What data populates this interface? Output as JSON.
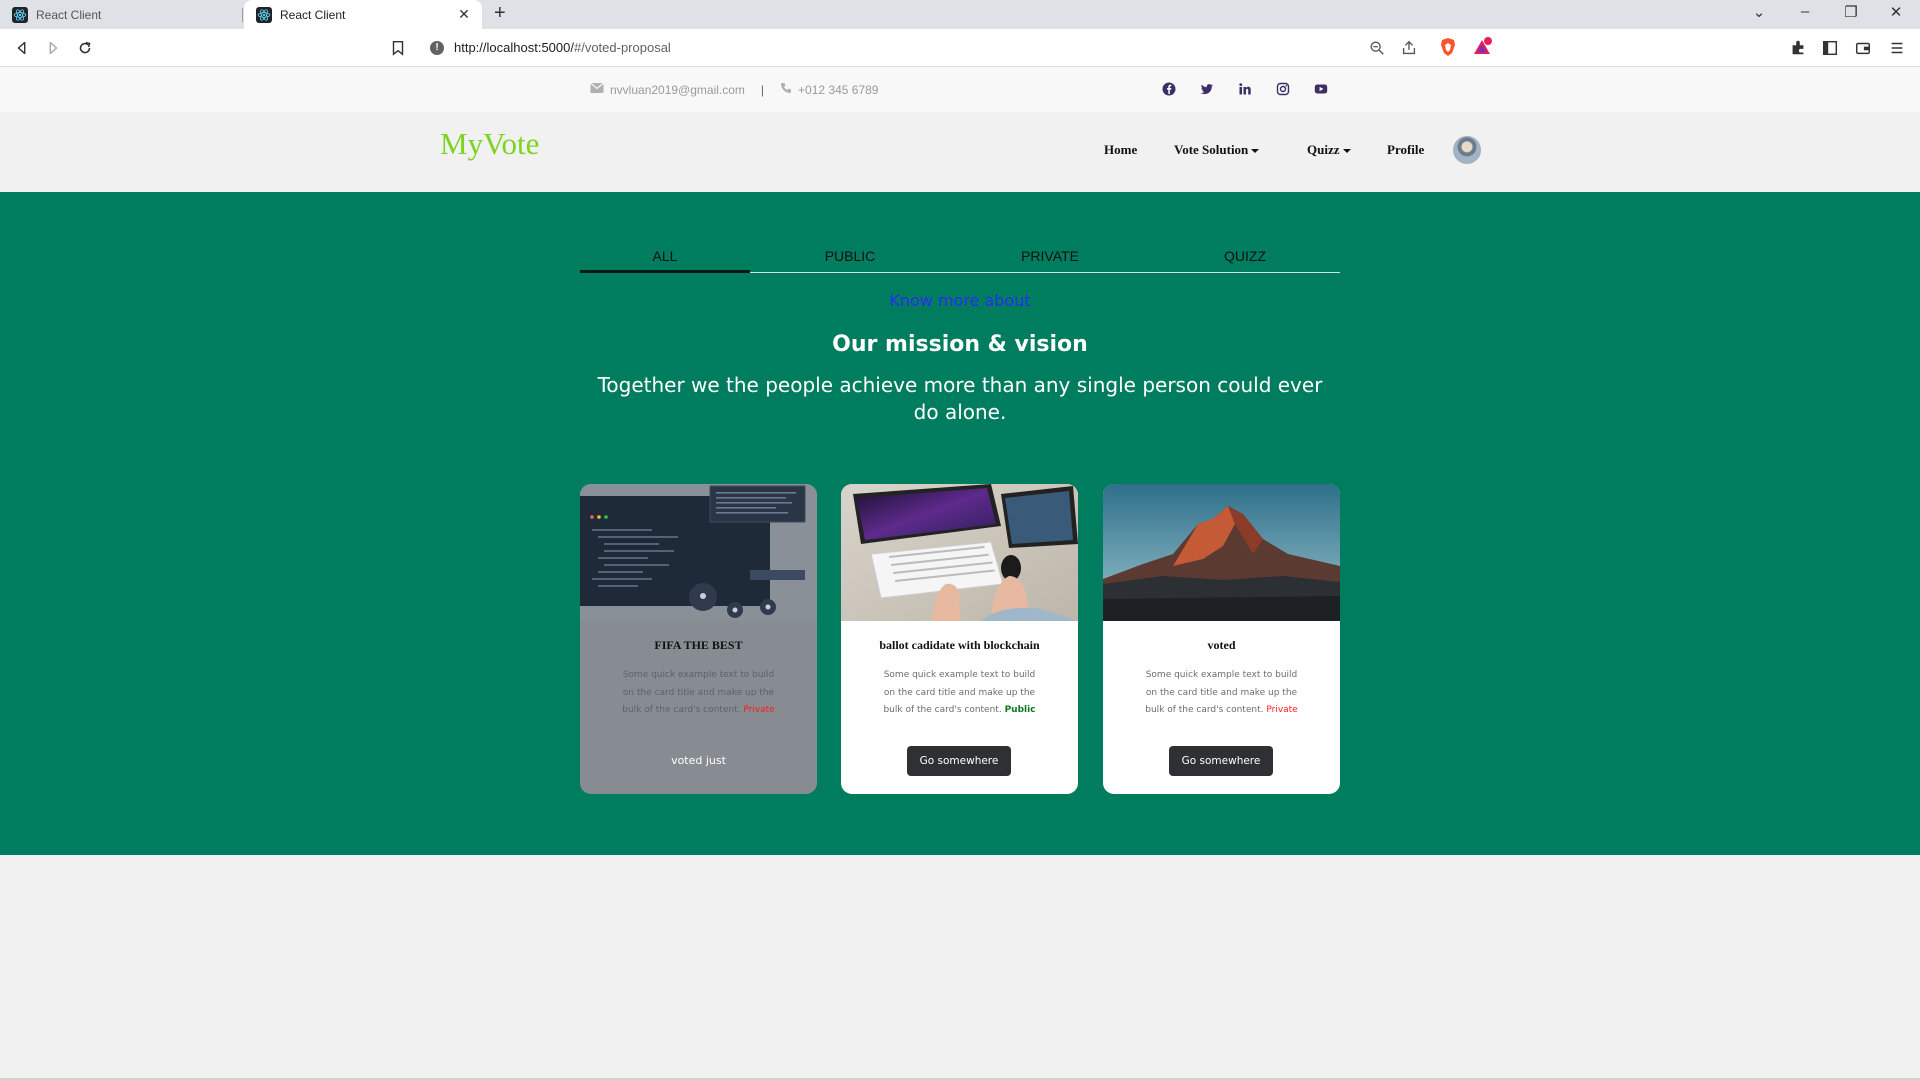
{
  "browser": {
    "tabs": [
      {
        "title": "React Client",
        "active": false
      },
      {
        "title": "React Client",
        "active": true
      }
    ],
    "url_host": "http://localhost:5000/",
    "url_path": "#/voted-proposal"
  },
  "topbar": {
    "email": "nvvluan2019@gmail.com",
    "separator": "|",
    "phone": "+012 345 6789",
    "social": [
      "facebook-icon",
      "twitter-icon",
      "linkedin-icon",
      "instagram-icon",
      "youtube-icon"
    ]
  },
  "navbar": {
    "brand": "MyVote",
    "links": [
      "Home",
      "Vote Solution",
      "Quizz",
      "Profile"
    ]
  },
  "hero": {
    "tabs": [
      "ALL",
      "PUBLIC",
      "PRIVATE",
      "QUIZZ"
    ],
    "active_tab": "ALL",
    "know_more": "Know more about",
    "mission_title": "Our mission & vision",
    "tagline": "Together we the people achieve more than any single person could ever do alone."
  },
  "cards": [
    {
      "title": "FIFA THE BEST",
      "text": "Some quick example text to build on the card title and make up the bulk of the card's content.",
      "badge": "Private",
      "action": "voted just",
      "disabled": true
    },
    {
      "title": "ballot cadidate with blockchain",
      "text": "Some quick example text to build on the card title and make up the bulk of the card's content.",
      "badge": "Public",
      "action": "Go somewhere",
      "disabled": false
    },
    {
      "title": "voted",
      "text": "Some quick example text to build on the card title and make up the bulk of the card's content.",
      "badge": "Private",
      "action": "Go somewhere",
      "disabled": false
    }
  ],
  "colors": {
    "hero_bg": "#007c5e",
    "brand": "#7dd321",
    "private": "#ff1a1a",
    "public": "#0b7a20"
  }
}
